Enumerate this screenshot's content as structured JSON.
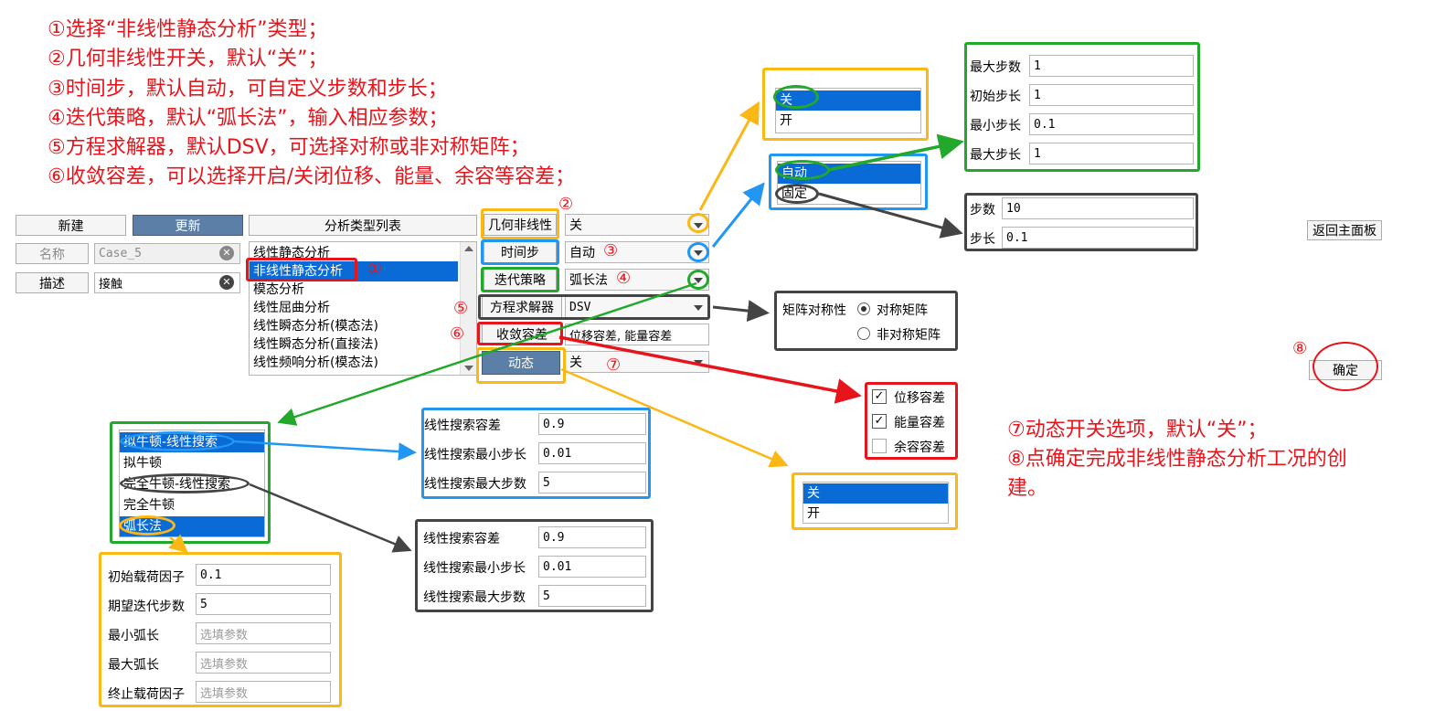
{
  "notes": [
    "①选择“非线性静态分析”类型；",
    "②几何非线性开关，默认“关”；",
    "③时间步，默认自动，可自定义步数和步长；",
    "④迭代策略，默认“弧长法”，输入相应参数；",
    "⑤方程求解器，默认DSV，可选择对称或非对称矩阵；",
    "⑥收敛容差，可以选择开启/关闭位移、能量、余容等容差；"
  ],
  "notes_right": [
    "⑦动态开关选项，默认“关”；",
    "⑧点确定完成非线性静态分析工况的创",
    "建。"
  ],
  "markers": {
    "m1": "①",
    "m2": "②",
    "m3": "③",
    "m4": "④",
    "m5": "⑤",
    "m6": "⑥",
    "m7": "⑦",
    "m8": "⑧"
  },
  "toolbar": {
    "new": "新建",
    "update": "更新",
    "analysis_list": "分析类型列表",
    "back": "返回主面板",
    "ok": "确定"
  },
  "form": {
    "name_label": "名称",
    "name_value": "Case_5",
    "desc_label": "描述",
    "desc_value": "接触"
  },
  "analysis_types": [
    "线性静态分析",
    "非线性静态分析",
    "模态分析",
    "线性屈曲分析",
    "线性瞬态分析(模态法)",
    "线性瞬态分析(直接法)",
    "线性频响分析(模态法)"
  ],
  "params": {
    "geo_nl": {
      "label": "几何非线性",
      "value": "关"
    },
    "timestep": {
      "label": "时间步",
      "value": "自动"
    },
    "iteration": {
      "label": "迭代策略",
      "value": "弧长法"
    },
    "solver": {
      "label": "方程求解器",
      "value": "DSV"
    },
    "convergence": {
      "label": "收敛容差",
      "value": "位移容差, 能量容差"
    },
    "dynamic": {
      "label": "动态",
      "value": "关"
    }
  },
  "popup_onoff": {
    "items": [
      "关",
      "开"
    ]
  },
  "popup_timestep": {
    "items": [
      "自动",
      "固定"
    ]
  },
  "auto_params": [
    {
      "label": "最大步数",
      "value": "1"
    },
    {
      "label": "初始步长",
      "value": "1"
    },
    {
      "label": "最小步长",
      "value": "0.1"
    },
    {
      "label": "最大步长",
      "value": "1"
    }
  ],
  "fixed_params": [
    {
      "label": "步数",
      "value": "10"
    },
    {
      "label": "步长",
      "value": "0.1"
    }
  ],
  "matrix": {
    "label": "矩阵对称性",
    "opt1": "对称矩阵",
    "opt2": "非对称矩阵"
  },
  "tolerances": [
    "位移容差",
    "能量容差",
    "余容容差"
  ],
  "dynamic_popup": {
    "items": [
      "关",
      "开"
    ]
  },
  "iter_list": [
    "拟牛顿-线性搜索",
    "拟牛顿",
    "完全牛顿-线性搜索",
    "完全牛顿",
    "弧长法"
  ],
  "ls_blue": [
    {
      "label": "线性搜索容差",
      "value": "0.9"
    },
    {
      "label": "线性搜索最小步长",
      "value": "0.01"
    },
    {
      "label": "线性搜索最大步数",
      "value": "5"
    }
  ],
  "ls_dark": [
    {
      "label": "线性搜索容差",
      "value": "0.9"
    },
    {
      "label": "线性搜索最小步长",
      "value": "0.01"
    },
    {
      "label": "线性搜索最大步数",
      "value": "5"
    }
  ],
  "arc_params": [
    {
      "label": "初始载荷因子",
      "value": "0.1"
    },
    {
      "label": "期望迭代步数",
      "value": "5"
    },
    {
      "label": "最小弧长",
      "value": "选填参数"
    },
    {
      "label": "最大弧长",
      "value": "选填参数"
    },
    {
      "label": "终止载荷因子",
      "value": "选填参数"
    }
  ],
  "colors": {
    "yellow": "#fbb713",
    "green": "#22a82a",
    "blue": "#2196f3",
    "dark": "#444444",
    "red": "#e8141b",
    "select": "#0a6ad6"
  }
}
